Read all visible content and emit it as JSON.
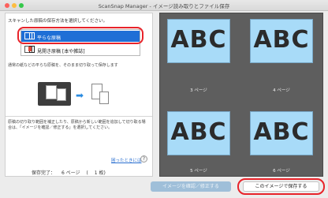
{
  "window": {
    "title": "ScanSnap Manager - イメージ読み取りとファイル保存"
  },
  "left": {
    "instruction": "スキャンした原稿の保存方法を選択してください。",
    "options": [
      {
        "label": "平らな原稿",
        "icon": "flat-document-icon",
        "selected": true
      },
      {
        "label": "見開き原稿 [本や雑誌]",
        "icon": "book-spread-icon",
        "selected": false
      }
    ],
    "description1": "通常の紙などの平らな原稿を、そのまま切り取って保存します",
    "description2": "原稿の切り取り範囲を補正したり、原稿から新しい範囲を追加して切り取る場合は、「イメージを確認／修正する」を選択してください。",
    "help_link": "困ったときには",
    "help_button": "?",
    "status": {
      "label": "保存完了：",
      "count": "6 ページ",
      "open_paren": "(",
      "files": "1 枚)"
    }
  },
  "preview": {
    "pages": [
      {
        "text": "ABC",
        "label": "3 ページ"
      },
      {
        "text": "ABC",
        "label": "4 ページ"
      },
      {
        "text": "ABC",
        "label": "5 ページ"
      },
      {
        "text": "ABC",
        "label": "6 ページ"
      }
    ]
  },
  "buttons": {
    "check_label": "イメージを確認／修正する",
    "save_label": "このイメージで保存する"
  },
  "colors": {
    "selected_option": "#1f6fd6",
    "highlight": "#e8232a",
    "thumbnail_bg": "#a8dbf8",
    "preview_bg": "#5e5e5e"
  }
}
